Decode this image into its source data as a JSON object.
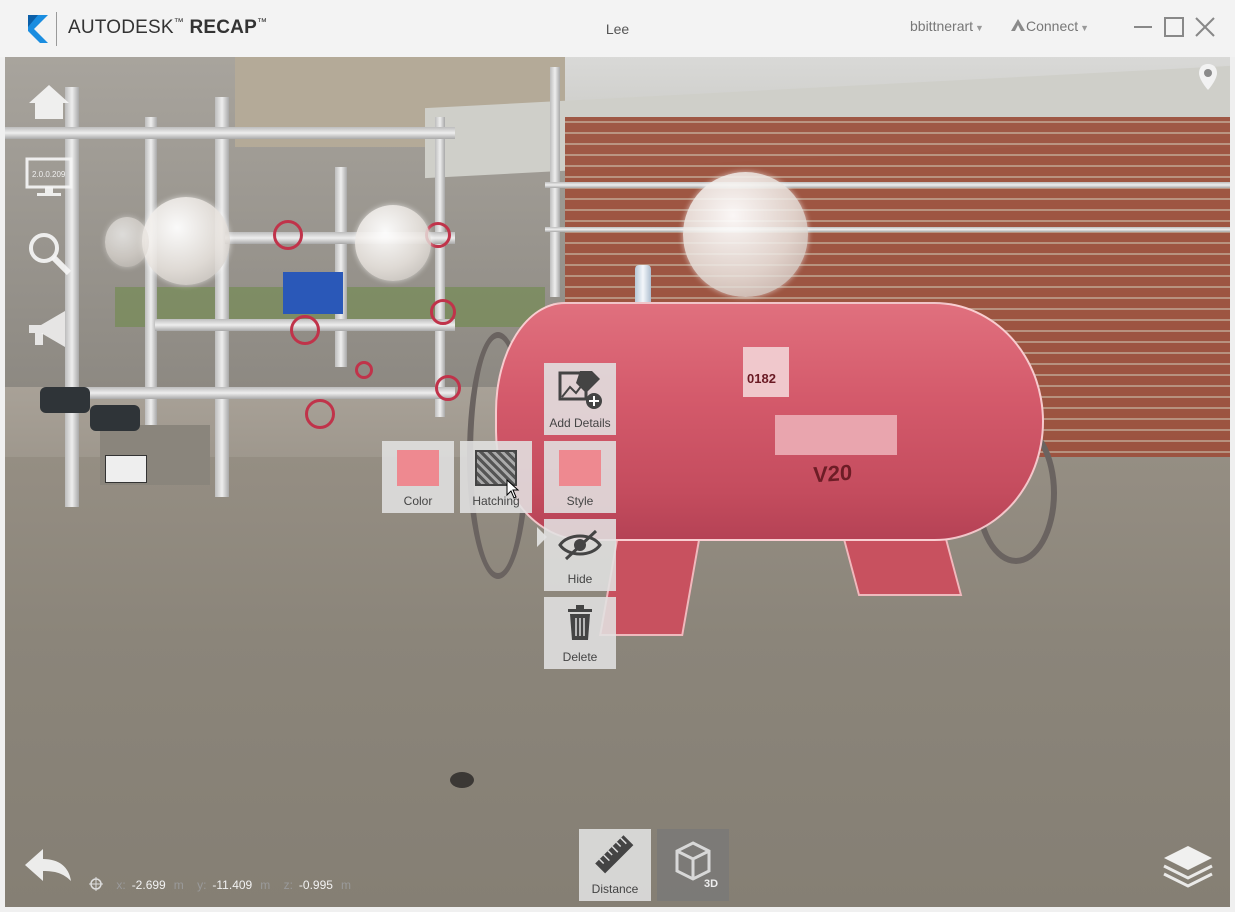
{
  "app": {
    "brand": "AUTODESK",
    "product": "RECAP",
    "tm": "™",
    "project_name": "Lee",
    "user": "bbittnerart",
    "connect_label": "Connect"
  },
  "scene": {
    "tank_number": "0182",
    "tank_marking": "V20"
  },
  "context_menu": {
    "add_details_label": "Add Details",
    "color_label": "Color",
    "hatching_label": "Hatching",
    "style_label": "Style",
    "hide_label": "Hide",
    "delete_label": "Delete",
    "swatch_color": "#ee8990"
  },
  "left_toolbar": {
    "items": [
      "home-icon",
      "display-icon",
      "search-icon",
      "megaphone-icon"
    ],
    "display_readout": "2.0.0.209"
  },
  "bottom_toolbar": {
    "distance_label": "Distance",
    "view3d_label": "3D"
  },
  "coordinates": {
    "x_key": "x:",
    "x_value": "-2.699",
    "y_key": "y:",
    "y_value": "-11.409",
    "z_key": "z:",
    "z_value": "-0.995",
    "unit": "m"
  }
}
